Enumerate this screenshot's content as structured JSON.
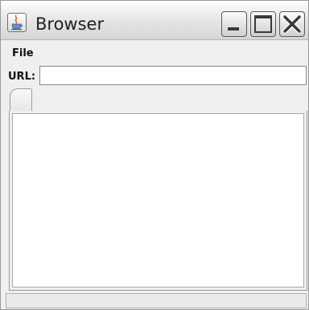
{
  "window": {
    "title": "Browser",
    "icon": "java-cup-icon",
    "controls": [
      "minimize-icon",
      "maximize-icon",
      "close-icon"
    ]
  },
  "menubar": {
    "items": [
      {
        "label": "File"
      }
    ]
  },
  "url_bar": {
    "label": "URL:",
    "value": "",
    "placeholder": ""
  },
  "tabs": [
    {
      "label": ""
    }
  ],
  "status": {
    "text": ""
  }
}
